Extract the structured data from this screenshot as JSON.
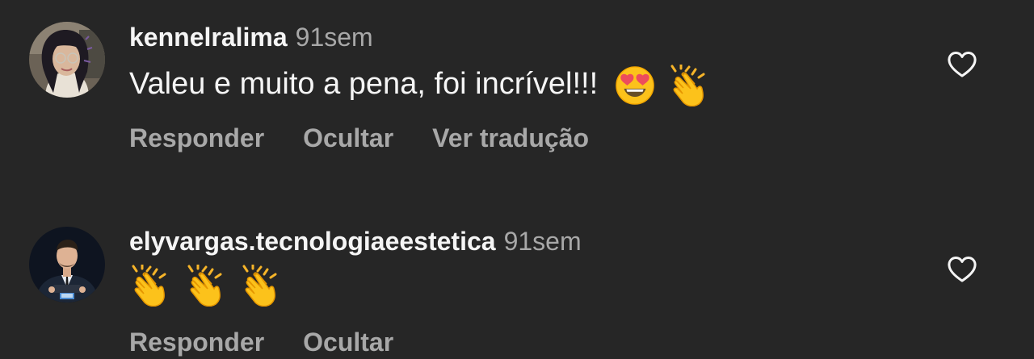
{
  "comments": [
    {
      "username": "kennelralima",
      "time": "91sem",
      "text": "Valeu e muito a pena, foi incrível!!!",
      "emojis": [
        "heart-eyes-emoji",
        "clapping-hands-emoji"
      ],
      "actions": [
        "Responder",
        "Ocultar",
        "Ver tradução"
      ],
      "liked": false
    },
    {
      "username": "elyvargas.tecnologiaeestetica",
      "time": "91sem",
      "text": "",
      "emojis": [
        "clapping-hands-emoji",
        "clapping-hands-emoji",
        "clapping-hands-emoji"
      ],
      "actions": [
        "Responder",
        "Ocultar"
      ],
      "liked": false
    }
  ],
  "colors": {
    "background": "#262626",
    "primary_text": "#f5f5f5",
    "secondary_text": "#a8a8a8"
  }
}
